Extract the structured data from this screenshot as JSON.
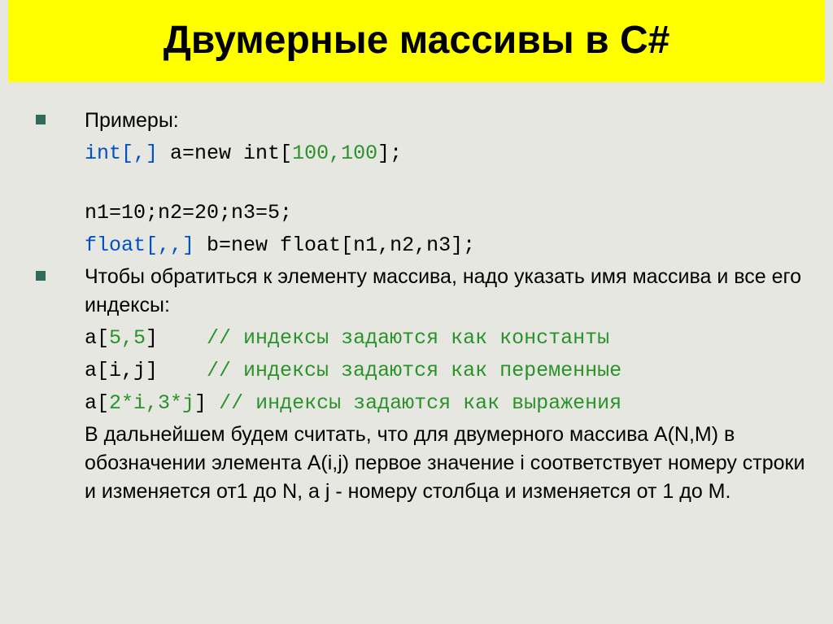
{
  "title": "Двумерные массивы в C#",
  "bullet1_label": "Примеры:",
  "code_line1_type": "int",
  "code_line1_brackets": "[,]",
  "code_line1_rest_a": " a=new int[",
  "code_line1_nums": "100,100",
  "code_line1_rest_b": "];",
  "code_line2_all": "n1=10;n2=20;n3=5;",
  "code_line3_type": "float",
  "code_line3_brackets": "[,,]",
  "code_line3_rest": " b=new float[n1,n2,n3];",
  "bullet2_text": "Чтобы обратиться к элементу массива, надо указать имя массива и все его индексы:",
  "idx_line1_a": "a[",
  "idx_line1_nums": "5,5",
  "idx_line1_b": "]    ",
  "idx_line1_comment": "// индексы задаются как константы",
  "idx_line2_a": "a[i,j]    ",
  "idx_line2_comment": "// индексы задаются как переменные",
  "idx_line3_a": "a[",
  "idx_line3_nums": "2*i,3*j",
  "idx_line3_b": "] ",
  "idx_line3_comment": "// индексы задаются как выражения",
  "para_text": "В дальнейшем будем считать, что для двумерного массива A(N,M) в обозначении элемента A(i,j) первое значение i соответствует номеру строки и изменяется от1 до N, а  j  - номеру столбца и изменяется от 1 до M."
}
